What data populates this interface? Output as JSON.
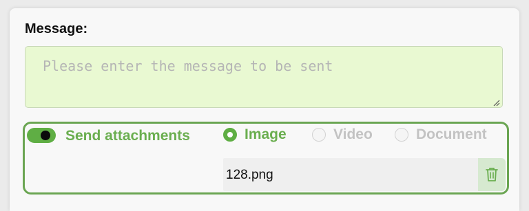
{
  "message": {
    "label": "Message:",
    "placeholder": "Please enter the message to be sent",
    "value": ""
  },
  "attachments": {
    "toggle_on": true,
    "toggle_label": "Send attachments",
    "types": [
      {
        "label": "Image",
        "selected": true
      },
      {
        "label": "Video",
        "selected": false
      },
      {
        "label": "Document",
        "selected": false
      }
    ],
    "file_name": "128.png",
    "delete_icon": "trash-icon"
  },
  "colors": {
    "accent_green": "#6aae4f",
    "textarea_bg": "#e9f9d2",
    "border_green": "#6aa552"
  }
}
